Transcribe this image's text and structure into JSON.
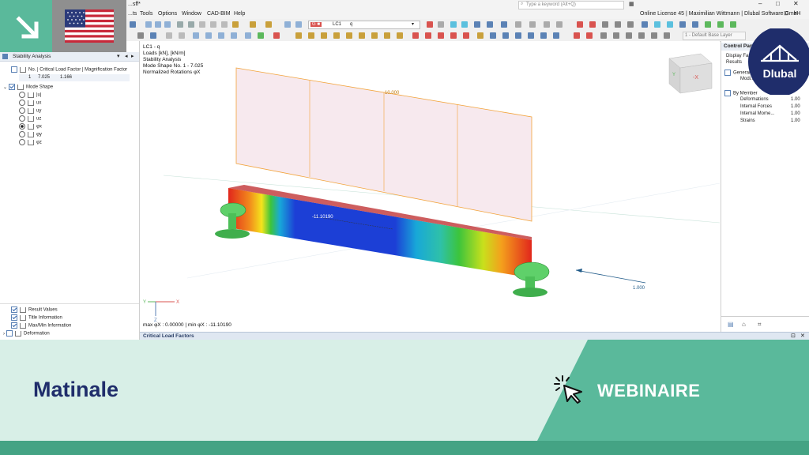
{
  "window": {
    "title": "...sff*",
    "search_placeholder": "Type a keyword (Alt+Q)",
    "license": "Online License 45 | Maximilian Wittmann | Dlubal Software GmbH"
  },
  "menu": [
    "...ts",
    "Tools",
    "Options",
    "Window",
    "CAD-BIM",
    "Help"
  ],
  "toolbar": {
    "load_case_badge": "G ■",
    "load_case": "LC1",
    "load_case_name": "q",
    "base_layer": "1 - Default Base Layer"
  },
  "nav": {
    "title": "Stability Analysis",
    "table_header": "No. | Critical Load Factor | Magnification Factor",
    "row_no": "1",
    "row_factor": "7.025",
    "row_mag": "1.166",
    "mode_shape": "Mode Shape",
    "options": [
      "|u|",
      "ux",
      "uy",
      "uz",
      "φx",
      "φy",
      "φz"
    ],
    "selected_index": 4,
    "bottom_items": [
      "Result Values",
      "Title Information",
      "Max/Min Information",
      "Deformation"
    ]
  },
  "viewport": {
    "info_lines": [
      "LC1 - q",
      "Loads [kN], [kN/m]",
      "Stability Analysis",
      "Mode Shape No. 1 - 7.025",
      "Normalized Rotations φX"
    ],
    "load_value": "10.000",
    "member_value": "-11.10190",
    "arrow_value": "1.000",
    "axis_x": "X",
    "axis_y": "Y",
    "axis_z": "Z",
    "cube_y": "Y",
    "cube_x": "-X",
    "maxmin": "max φX : 0.00000 | min φX : -11.10190"
  },
  "control_panel": {
    "title": "Control Panel",
    "display_line1": "Display Fa...",
    "display_line2": "Results",
    "general": "General",
    "modi": "Modi...",
    "by_member": "By Member",
    "rows": [
      {
        "label": "Deformations",
        "value": "1.00"
      },
      {
        "label": "Internal Forces",
        "value": "1.00"
      },
      {
        "label": "Internal Mome...",
        "value": "1.00"
      },
      {
        "label": "Strains",
        "value": "1.00"
      }
    ]
  },
  "results_strip": {
    "title": "Critical Load Factors"
  },
  "banner": {
    "left_text": "Matinale",
    "right_text": "WEBINAIRE",
    "logo_text": "Dlubal"
  },
  "colors": {
    "teal": "#5ab99b",
    "teal_dark": "#44a384",
    "banner_light": "#d8efe7",
    "navy": "#1f2d6b",
    "load_orange": "#f2a33a"
  }
}
